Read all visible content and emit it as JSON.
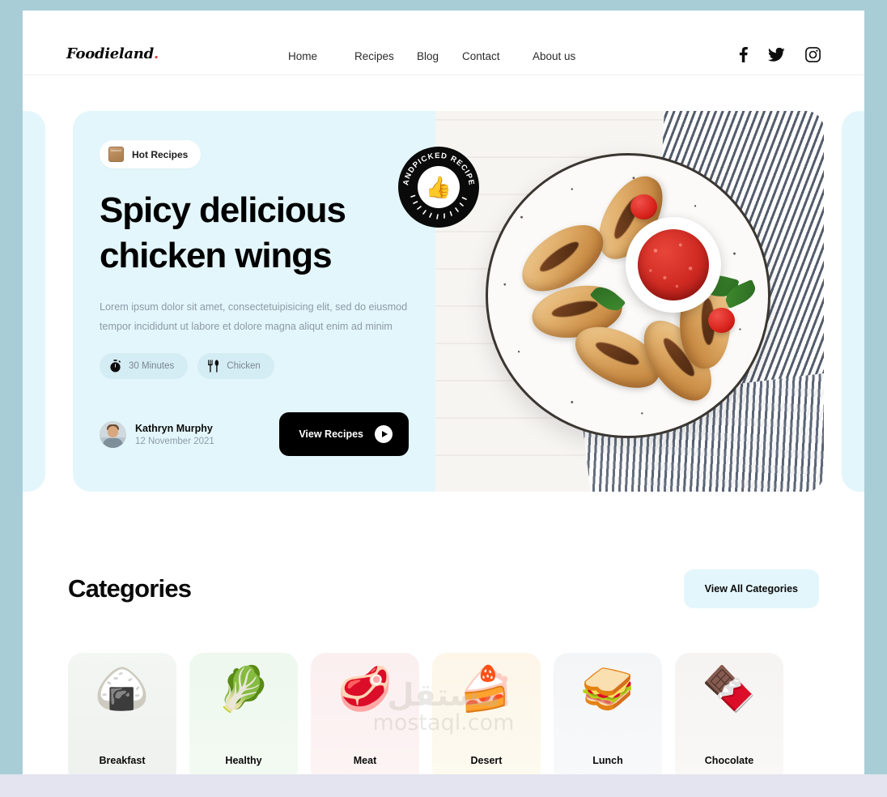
{
  "brand": {
    "name": "Foodieland",
    "dot": "."
  },
  "nav": {
    "items": [
      {
        "label": "Home"
      },
      {
        "label": "Recipes"
      },
      {
        "label": "Blog"
      },
      {
        "label": "Contact"
      },
      {
        "label": "About us"
      }
    ]
  },
  "socials": [
    {
      "name": "facebook-icon"
    },
    {
      "name": "twitter-icon"
    },
    {
      "name": "instagram-icon"
    }
  ],
  "hero": {
    "badge": "Hot Recipes",
    "title": "Spicy delicious chicken wings",
    "description": "Lorem ipsum dolor sit amet, consectetuipisicing elit, sed do eiusmod tempor incididunt ut labore et dolore magna aliqut enim ad minim",
    "meta": [
      {
        "icon": "stopwatch-icon",
        "label": "30 Minutes"
      },
      {
        "icon": "cutlery-icon",
        "label": "Chicken"
      }
    ],
    "author": {
      "name": "Kathryn Murphy",
      "date": "12 November 2021"
    },
    "cta": "View Recipes",
    "stamp": {
      "text": "HANDPICKED RECIPES",
      "emoji": "👍"
    }
  },
  "categories": {
    "title": "Categories",
    "view_all": "View All Categories",
    "items": [
      {
        "label": "Breakfast",
        "emoji": "🍙",
        "bg": "linear-gradient(180deg,#f3f6f3 0%,#eef1ee 100%)"
      },
      {
        "label": "Healthy",
        "emoji": "🥬",
        "bg": "linear-gradient(180deg,#eef8ee 0%,#f3faf3 100%)"
      },
      {
        "label": "Meat",
        "emoji": "🥩",
        "bg": "linear-gradient(180deg,#fbeff0 0%,#fdf4f4 100%)"
      },
      {
        "label": "Desert",
        "emoji": "🍰",
        "bg": "linear-gradient(180deg,#fdf6e9 0%,#fdfaf0 100%)"
      },
      {
        "label": "Lunch",
        "emoji": "🥪",
        "bg": "linear-gradient(180deg,#f4f5f7 0%,#f8f9fa 100%)"
      },
      {
        "label": "Chocolate",
        "emoji": "🍫",
        "bg": "linear-gradient(180deg,#f6f4f2 0%,#faf8f7 100%)"
      }
    ]
  },
  "watermark": {
    "arabic": "مستقل",
    "latin": "mostaql.com"
  },
  "colors": {
    "frame": "#a9cdd6",
    "hero_bg": "#e3f6fb",
    "accent_dark": "#000000",
    "muted_text": "#8d9aa6",
    "logo_dot": "#e23e3e"
  }
}
